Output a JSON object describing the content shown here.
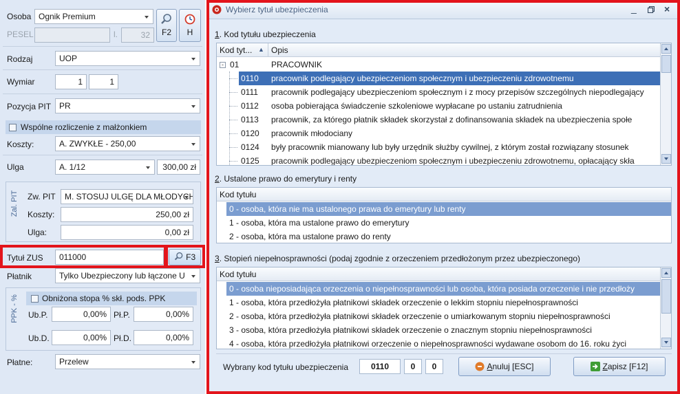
{
  "left": {
    "osoba_label": "Osoba",
    "osoba_value": "Ognik Premium",
    "pesel_label": "PESEL",
    "l_label": "l.",
    "l_value": "32",
    "btn_f2": "F2",
    "btn_h": "H",
    "rodzaj_label": "Rodzaj",
    "rodzaj_value": "UOP",
    "wymiar_label": "Wymiar",
    "wymiar_a": "1",
    "wymiar_b": "1",
    "pozycja_label": "Pozycja PIT",
    "pozycja_value": "PR",
    "wspolne_label": "Wspólne rozliczenie z małżonkiem",
    "koszty_label": "Koszty:",
    "koszty_value": "A. ZWYKŁE - 250,00",
    "ulga_label": "Ulga",
    "ulga_value": "A. 1/12",
    "ulga_amount": "300,00 zł",
    "zal_pit_label": "Zal. PIT",
    "zw_pit_label": "Zw. PIT",
    "zw_pit_value": "M. STOSUJ ULGĘ DLA MŁODYCH",
    "zal_koszty_label": "Koszty:",
    "zal_koszty_value": "250,00 zł",
    "zal_ulga_label": "Ulga:",
    "zal_ulga_value": "0,00 zł",
    "tytul_label": "Tytuł ZUS",
    "tytul_value": "011000",
    "btn_f3": "F3",
    "platnik_label": "Płatnik",
    "platnik_value": "Tylko Ubezpieczony lub łączone U",
    "ppk_label": "PPK - %",
    "obnizona_label": "Obniżona stopa % skł. pods. PPK",
    "ubp_label": "Ub.P.",
    "ubp_value": "0,00%",
    "plp_label": "Pł.P.",
    "plp_value": "0,00%",
    "ubd_label": "Ub.D.",
    "ubd_value": "0,00%",
    "pld_label": "Pł.D.",
    "pld_value": "0,00%",
    "platne_label": "Płatne:",
    "platne_value": "Przelew"
  },
  "dialog": {
    "title": "Wybierz tytuł ubezpieczenia",
    "section1_num": "1",
    "section1_title": ". Kod tytułu ubezpieczenia",
    "col_kod": "Kod tyt...",
    "col_opis": "Opis",
    "group_code": "01",
    "group_label": "PRACOWNIK",
    "rows1": [
      {
        "code": "0110",
        "desc": "pracownik podlegający ubezpieczeniom społecznym i ubezpieczeniu zdrowotnemu"
      },
      {
        "code": "0111",
        "desc": "pracownik podlegający ubezpieczeniom społecznym i z mocy przepisów szczególnych niepodlegający"
      },
      {
        "code": "0112",
        "desc": "osoba pobierająca świadczenie szkoleniowe wypłacane po ustaniu zatrudnienia"
      },
      {
        "code": "0113",
        "desc": "pracownik, za którego płatnik składek skorzystał z dofinansowania składek na ubezpieczenia społe"
      },
      {
        "code": "0120",
        "desc": "pracownik młodociany"
      },
      {
        "code": "0124",
        "desc": "były pracownik mianowany lub były urzędnik służby cywilnej, z którym został rozwiązany stosunek"
      },
      {
        "code": "0125",
        "desc": "pracownik podlegający ubezpieczeniom społecznym i ubezpieczeniu zdrowotnemu, opłacający skła"
      }
    ],
    "section2_num": "2",
    "section2_title": ". Ustalone prawo do emerytury i renty",
    "col_kod2": "Kod tytułu",
    "rows2": [
      "0 - osoba, która nie ma ustalonego prawa do emerytury lub renty",
      "1 - osoba, która ma ustalone prawo do emerytury",
      "2 - osoba, która ma ustalone prawo do renty"
    ],
    "section3_num": "3",
    "section3_title": ". Stopień niepełnosprawności (podaj zgodnie z orzeczeniem przedłożonym przez ubezpieczonego)",
    "col_kod3": "Kod tytułu",
    "rows3": [
      "0 - osoba nieposiadająca orzeczenia o niepełnosprawności lub osoba, która posiada orzeczenie i nie przedłoży",
      "1 - osoba, która przedłożyła płatnikowi składek orzeczenie o lekkim stopniu niepełnosprawności",
      "2 - osoba, która przedłożyła płatnikowi składek orzeczenie o umiarkowanym stopniu niepełnosprawności",
      "3 - osoba, która przedłożyła płatnikowi składek orzeczenie o znacznym stopniu niepełnosprawności",
      "4 - osoba, która przedłożyła płatnikowi orzeczenie o niepełnosprawności wydawane osobom do 16. roku życi"
    ],
    "selected_label": "Wybrany kod tytułu ubezpieczenia",
    "selected_code": "0110",
    "selected_b": "0",
    "selected_c": "0",
    "cancel_key": "A",
    "cancel_rest": "nuluj [ESC]",
    "save_key": "Z",
    "save_rest": "apisz [F12]"
  },
  "colors": {
    "highlight": "#e3141b",
    "selection": "#3d6fb6"
  }
}
